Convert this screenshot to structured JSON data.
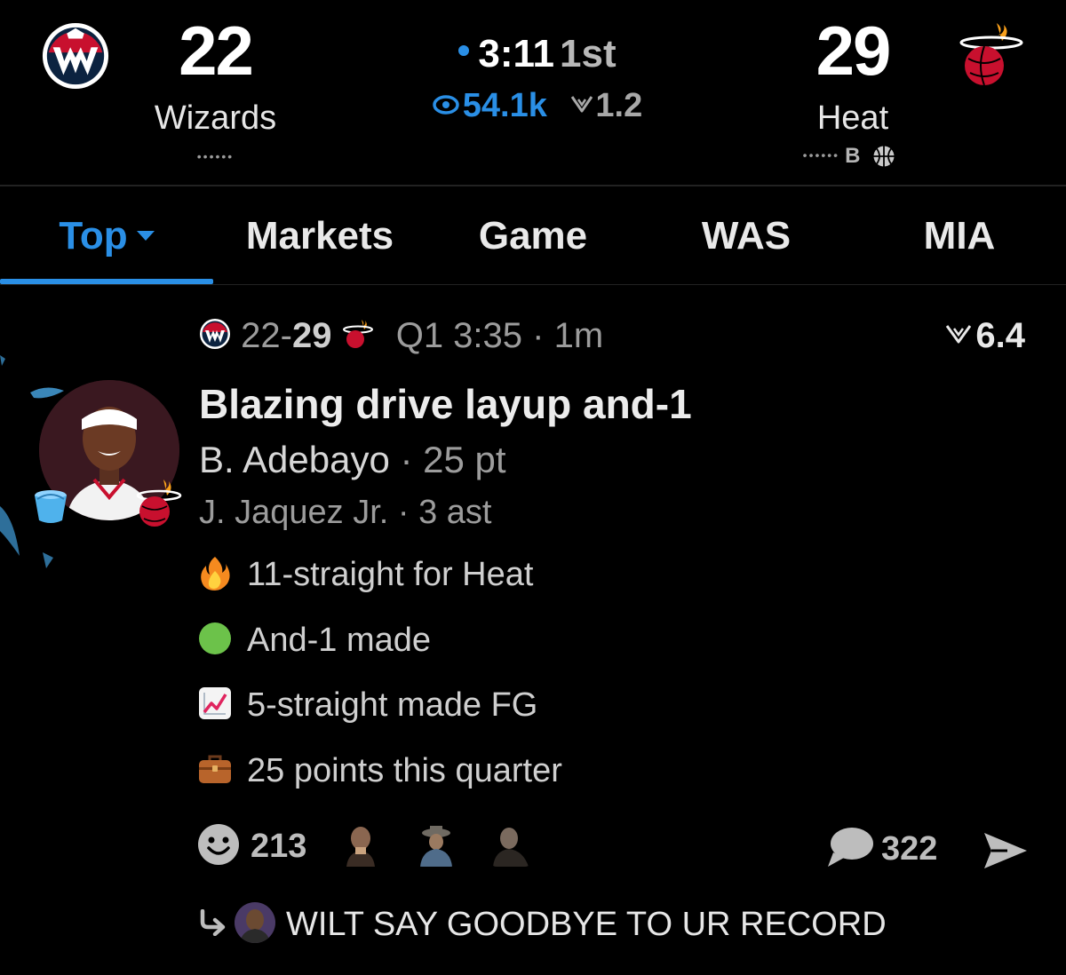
{
  "game": {
    "home": {
      "abbr": "WAS",
      "name": "Wizards",
      "score": "22",
      "timeouts": "••••••"
    },
    "away": {
      "abbr": "MIA",
      "name": "Heat",
      "score": "29",
      "timeouts": "••••••",
      "bonus": "B"
    },
    "clock": "3:11",
    "period": "1st",
    "viewers": "54.1k",
    "heat_rating": "1.2"
  },
  "tabs": [
    {
      "label": "Top",
      "active": true
    },
    {
      "label": "Markets"
    },
    {
      "label": "Game"
    },
    {
      "label": "WAS"
    },
    {
      "label": "MIA"
    }
  ],
  "play": {
    "score_home": "22",
    "score_sep": "-",
    "score_away": "29",
    "quarter_time": "Q1 3:35",
    "age": "· 1m",
    "hot_value": "6.4",
    "title": "Blazing drive layup and-1",
    "scorer_name": "B. Adebayo",
    "scorer_stat": "· 25 pt",
    "assist": "J. Jaquez Jr. · 3 ast",
    "notes": [
      {
        "icon": "fire-icon",
        "text": "11-straight for Heat"
      },
      {
        "icon": "green-circle-icon",
        "text": "And-1 made"
      },
      {
        "icon": "chart-increasing-icon",
        "text": "5-straight made FG"
      },
      {
        "icon": "briefcase-icon",
        "text": "25 points this quarter"
      }
    ],
    "reactions": "213",
    "comments": "322",
    "top_reply": "WILT SAY GOODBYE TO UR RECORD"
  },
  "colors": {
    "accent": "#2a8fe6",
    "background": "#000000",
    "heat_red": "#c8102e",
    "wizards_navy": "#0c2340"
  }
}
